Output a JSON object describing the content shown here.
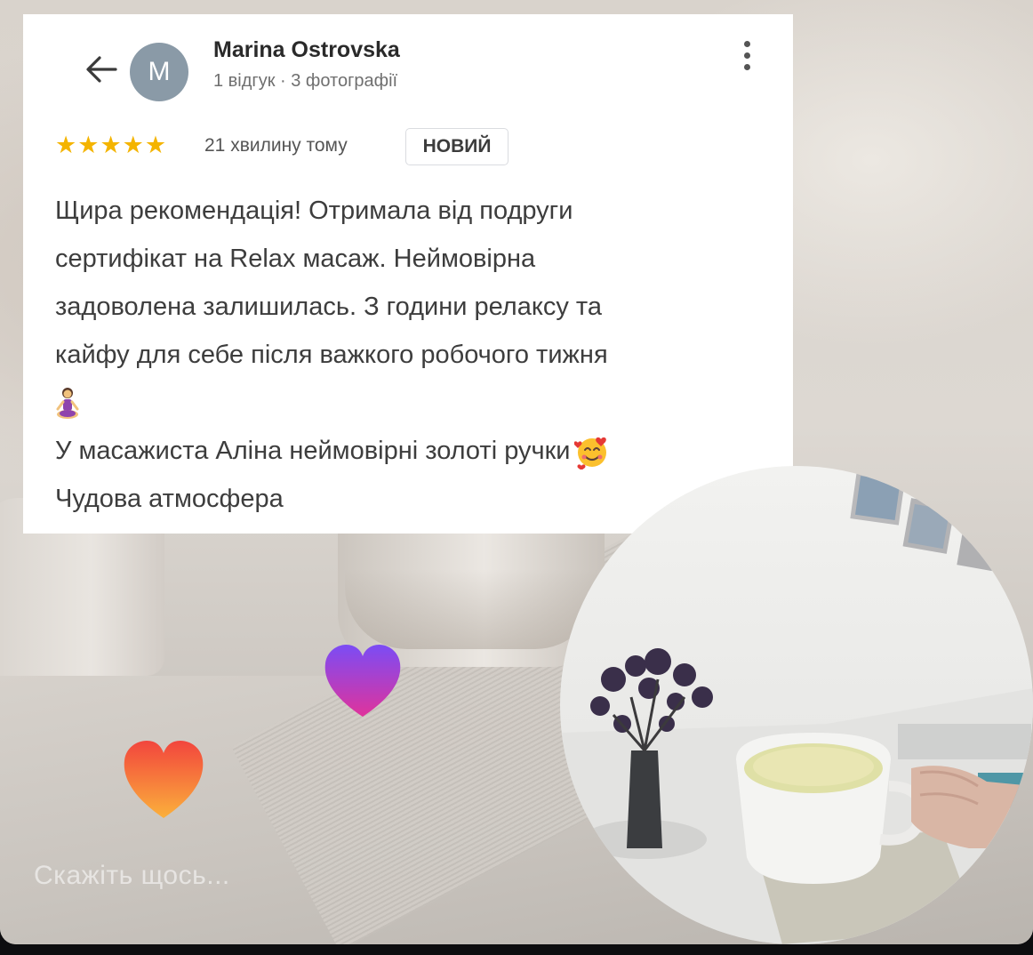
{
  "review": {
    "avatar_letter": "M",
    "reviewer_name": "Marina Ostrovska",
    "reviewer_meta": "1 відгук · 3 фотографії",
    "rating": 5,
    "rating_stars": [
      "★",
      "★",
      "★",
      "★",
      "★"
    ],
    "time_ago": "21 хвилину тому",
    "badge": "НОВИЙ",
    "text_lines": [
      "Щира рекомендація! Отримала від подруги",
      "сертифікат на Relax масаж. Неймовірна",
      "задоволена залишилась. З години релаксу та",
      "кайфу для себе після важкого робочого тижня",
      "У масажиста Аліна неймовірні золоті ручки",
      "Чудова атмосфера"
    ]
  },
  "icons": {
    "back": "arrow-left-icon",
    "more": "more-vert-icon",
    "star": "star-icon",
    "meditation_emoji": "person-in-lotus-position-emoji",
    "smile_emoji": "smiling-face-with-hearts-emoji",
    "heart_purple": "heart-icon",
    "heart_orange": "heart-icon"
  },
  "colors": {
    "star": "#f4b400",
    "avatar": "#8a9aa7",
    "heart_purple_top": "#7b4cf5",
    "heart_purple_bottom": "#e0339b",
    "heart_orange_top": "#f2453d",
    "heart_orange_bottom": "#fbb03b"
  },
  "comment_input": {
    "placeholder": "Скажіть щось..."
  }
}
